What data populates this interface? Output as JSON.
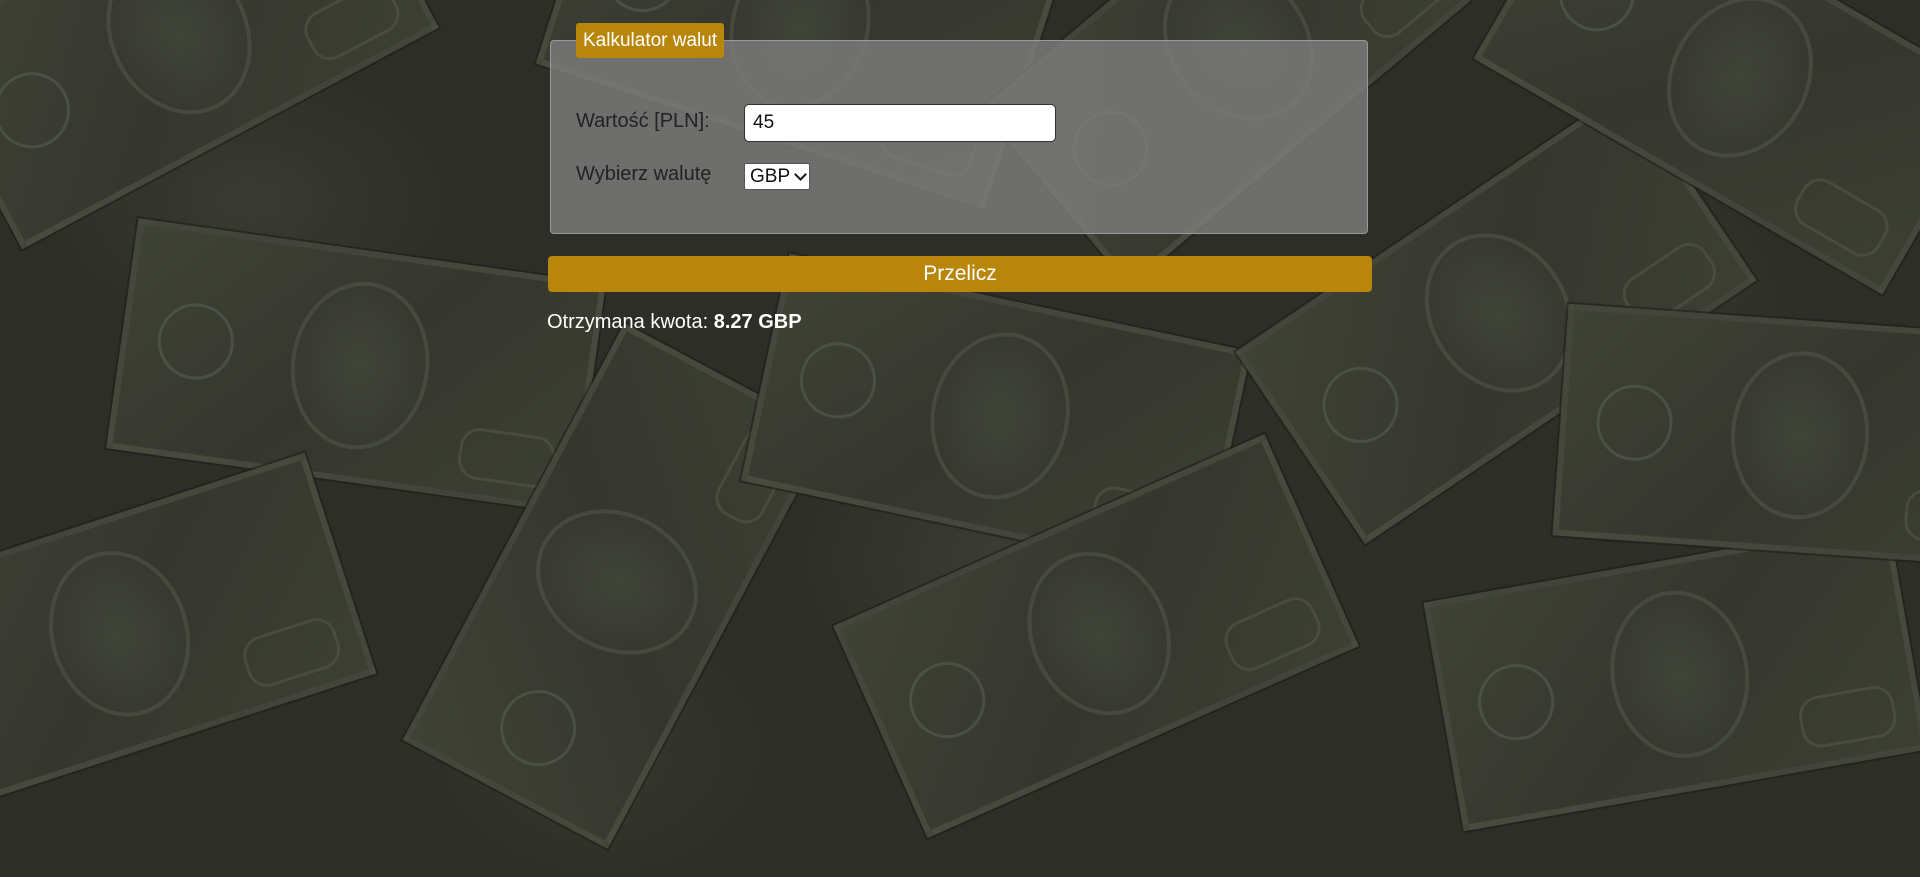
{
  "form": {
    "legend": "Kalkulator walut",
    "value_label": "Wartość [PLN]:",
    "value_input": "45",
    "currency_label": "Wybierz walutę",
    "currency_selected": "GBP",
    "submit_label": "Przelicz"
  },
  "result": {
    "label": "Otrzymana kwota:",
    "amount": "8.27 GBP"
  },
  "colors": {
    "accent": "#b8860b",
    "panel": "#808080",
    "background": "#2b2b25"
  },
  "icons": {
    "select_arrow": "chevron-down-icon"
  }
}
